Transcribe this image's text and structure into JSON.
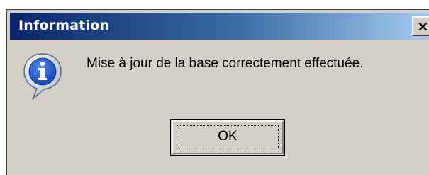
{
  "window": {
    "title": "Information",
    "close_label": "×"
  },
  "dialog": {
    "icon": "info-icon",
    "message": "Mise à jour de la base correctement effectuée.",
    "ok_label": "OK"
  },
  "colors": {
    "titlebar_start": "#0a246a",
    "titlebar_end": "#a6caf0",
    "dialog_background": "#d4d0c8",
    "icon_blue": "#1b56c8"
  }
}
